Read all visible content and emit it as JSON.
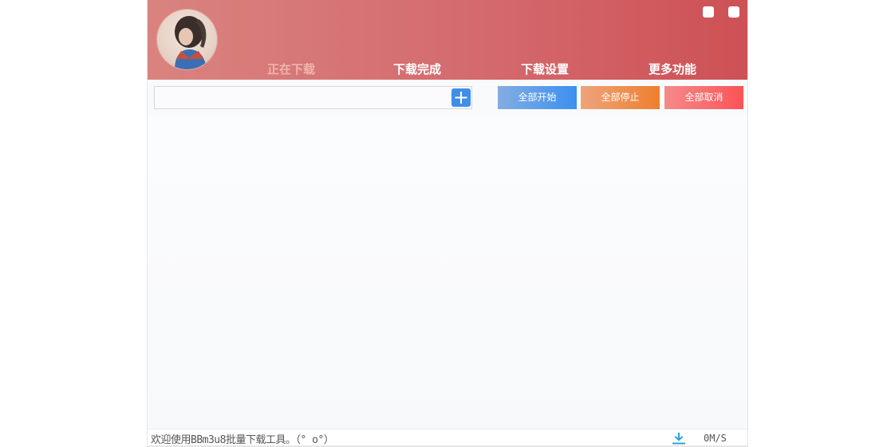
{
  "header": {
    "tabs": [
      {
        "label": "正在下载",
        "active": true
      },
      {
        "label": "下载完成",
        "active": false
      },
      {
        "label": "下载设置",
        "active": false
      },
      {
        "label": "更多功能",
        "active": false
      }
    ]
  },
  "toolbar": {
    "url_input_value": "",
    "add_icon": "plus-icon",
    "start_all_label": "全部开始",
    "stop_all_label": "全部停止",
    "cancel_all_label": "全部取消"
  },
  "statusbar": {
    "message": "欢迎使用BBm3u8批量下载工具。（° o°）",
    "download_icon": "download-icon",
    "speed": "0M/S"
  },
  "colors": {
    "header_start": "#d9837f",
    "header_end": "#cd5155",
    "start_button": "#3b90f0",
    "stop_button": "#ef7f2e",
    "cancel_button": "#fb5356",
    "add_button": "#3f8ee8",
    "download_icon": "#2aa3d8"
  }
}
